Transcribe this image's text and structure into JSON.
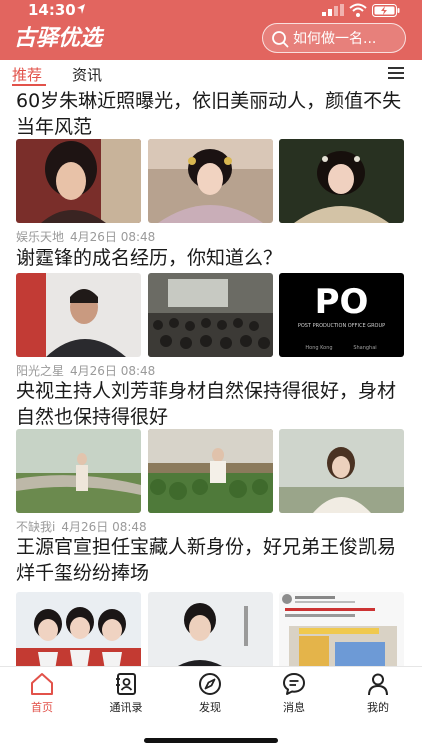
{
  "status_bar": {
    "time": "14:30"
  },
  "app_bar": {
    "logo_text": "古驿优选",
    "search_placeholder": "如何做一名..."
  },
  "tabs": [
    {
      "label": "推荐",
      "active": true
    },
    {
      "label": "资讯",
      "active": false
    }
  ],
  "articles": [
    {
      "title": "60岁朱琳近照曝光，依旧美丽动人，颜值不失当年风范",
      "source": "娱乐天地",
      "time": "4月26日 08:48",
      "images": [
        "portrait-woman-icon",
        "costume-drama-icon",
        "costume-drama-icon"
      ]
    },
    {
      "title": "谢霆锋的成名经历，你知道么？",
      "source": "阳光之星",
      "time": "4月26日 08:48",
      "images": [
        "portrait-man-icon",
        "audience-icon",
        "po-logo-icon"
      ],
      "po_logo": {
        "big": "PO",
        "caption": "POST PRODUCTION OFFICE GROUP",
        "city_left": "Hong Kong",
        "city_right": "Shanghai"
      }
    },
    {
      "title": "央视主持人刘芳菲身材自然保持得很好，身材自然也保持得很好",
      "source": "不缺我i",
      "time": "4月26日 08:48",
      "images": [
        "outdoor-woman-icon",
        "vegetable-field-icon",
        "outdoor-woman-icon"
      ]
    },
    {
      "title": "王源官宣担任宝藏人新身份，好兄弟王俊凯易烊千玺纷纷捧场",
      "source": "",
      "time": "",
      "images": [
        "group-photo-icon",
        "portrait-man-icon",
        "social-post-icon"
      ]
    }
  ],
  "tab_bar": [
    {
      "label": "首页",
      "icon": "home-icon",
      "active": true
    },
    {
      "label": "通讯录",
      "icon": "contacts-icon",
      "active": false
    },
    {
      "label": "发现",
      "icon": "compass-icon",
      "active": false
    },
    {
      "label": "消息",
      "icon": "message-icon",
      "active": false
    },
    {
      "label": "我的",
      "icon": "user-icon",
      "active": false
    }
  ],
  "colors": {
    "brand": "#e2655f",
    "accent": "#e2524a"
  }
}
